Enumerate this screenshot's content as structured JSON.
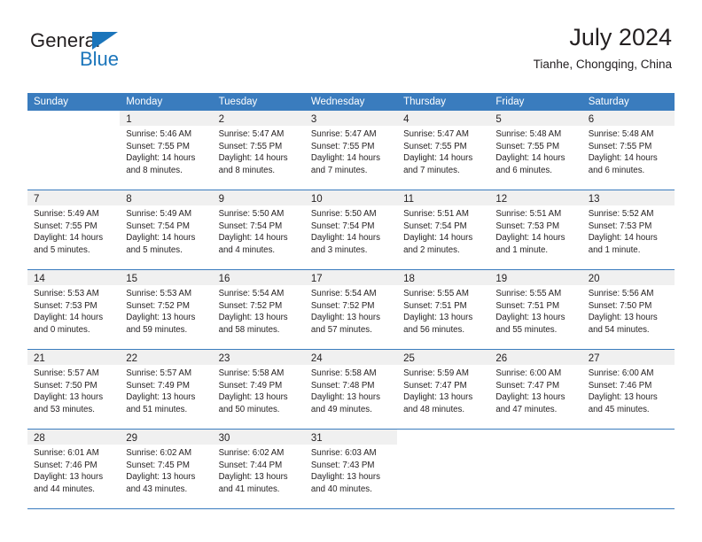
{
  "brand": {
    "name_dark": "General",
    "name_blue": "Blue",
    "flag_icon": "triangle-flag-icon",
    "accent_color": "#1b75bb"
  },
  "header": {
    "title": "July 2024",
    "subtitle": "Tianhe, Chongqing, China"
  },
  "calendar": {
    "header_color": "#3a7cbe",
    "weekdays": [
      "Sunday",
      "Monday",
      "Tuesday",
      "Wednesday",
      "Thursday",
      "Friday",
      "Saturday"
    ],
    "weeks": [
      [
        {
          "day": "",
          "lines": []
        },
        {
          "day": "1",
          "lines": [
            "Sunrise: 5:46 AM",
            "Sunset: 7:55 PM",
            "Daylight: 14 hours",
            "and 8 minutes."
          ]
        },
        {
          "day": "2",
          "lines": [
            "Sunrise: 5:47 AM",
            "Sunset: 7:55 PM",
            "Daylight: 14 hours",
            "and 8 minutes."
          ]
        },
        {
          "day": "3",
          "lines": [
            "Sunrise: 5:47 AM",
            "Sunset: 7:55 PM",
            "Daylight: 14 hours",
            "and 7 minutes."
          ]
        },
        {
          "day": "4",
          "lines": [
            "Sunrise: 5:47 AM",
            "Sunset: 7:55 PM",
            "Daylight: 14 hours",
            "and 7 minutes."
          ]
        },
        {
          "day": "5",
          "lines": [
            "Sunrise: 5:48 AM",
            "Sunset: 7:55 PM",
            "Daylight: 14 hours",
            "and 6 minutes."
          ]
        },
        {
          "day": "6",
          "lines": [
            "Sunrise: 5:48 AM",
            "Sunset: 7:55 PM",
            "Daylight: 14 hours",
            "and 6 minutes."
          ]
        }
      ],
      [
        {
          "day": "7",
          "lines": [
            "Sunrise: 5:49 AM",
            "Sunset: 7:55 PM",
            "Daylight: 14 hours",
            "and 5 minutes."
          ]
        },
        {
          "day": "8",
          "lines": [
            "Sunrise: 5:49 AM",
            "Sunset: 7:54 PM",
            "Daylight: 14 hours",
            "and 5 minutes."
          ]
        },
        {
          "day": "9",
          "lines": [
            "Sunrise: 5:50 AM",
            "Sunset: 7:54 PM",
            "Daylight: 14 hours",
            "and 4 minutes."
          ]
        },
        {
          "day": "10",
          "lines": [
            "Sunrise: 5:50 AM",
            "Sunset: 7:54 PM",
            "Daylight: 14 hours",
            "and 3 minutes."
          ]
        },
        {
          "day": "11",
          "lines": [
            "Sunrise: 5:51 AM",
            "Sunset: 7:54 PM",
            "Daylight: 14 hours",
            "and 2 minutes."
          ]
        },
        {
          "day": "12",
          "lines": [
            "Sunrise: 5:51 AM",
            "Sunset: 7:53 PM",
            "Daylight: 14 hours",
            "and 1 minute."
          ]
        },
        {
          "day": "13",
          "lines": [
            "Sunrise: 5:52 AM",
            "Sunset: 7:53 PM",
            "Daylight: 14 hours",
            "and 1 minute."
          ]
        }
      ],
      [
        {
          "day": "14",
          "lines": [
            "Sunrise: 5:53 AM",
            "Sunset: 7:53 PM",
            "Daylight: 14 hours",
            "and 0 minutes."
          ]
        },
        {
          "day": "15",
          "lines": [
            "Sunrise: 5:53 AM",
            "Sunset: 7:52 PM",
            "Daylight: 13 hours",
            "and 59 minutes."
          ]
        },
        {
          "day": "16",
          "lines": [
            "Sunrise: 5:54 AM",
            "Sunset: 7:52 PM",
            "Daylight: 13 hours",
            "and 58 minutes."
          ]
        },
        {
          "day": "17",
          "lines": [
            "Sunrise: 5:54 AM",
            "Sunset: 7:52 PM",
            "Daylight: 13 hours",
            "and 57 minutes."
          ]
        },
        {
          "day": "18",
          "lines": [
            "Sunrise: 5:55 AM",
            "Sunset: 7:51 PM",
            "Daylight: 13 hours",
            "and 56 minutes."
          ]
        },
        {
          "day": "19",
          "lines": [
            "Sunrise: 5:55 AM",
            "Sunset: 7:51 PM",
            "Daylight: 13 hours",
            "and 55 minutes."
          ]
        },
        {
          "day": "20",
          "lines": [
            "Sunrise: 5:56 AM",
            "Sunset: 7:50 PM",
            "Daylight: 13 hours",
            "and 54 minutes."
          ]
        }
      ],
      [
        {
          "day": "21",
          "lines": [
            "Sunrise: 5:57 AM",
            "Sunset: 7:50 PM",
            "Daylight: 13 hours",
            "and 53 minutes."
          ]
        },
        {
          "day": "22",
          "lines": [
            "Sunrise: 5:57 AM",
            "Sunset: 7:49 PM",
            "Daylight: 13 hours",
            "and 51 minutes."
          ]
        },
        {
          "day": "23",
          "lines": [
            "Sunrise: 5:58 AM",
            "Sunset: 7:49 PM",
            "Daylight: 13 hours",
            "and 50 minutes."
          ]
        },
        {
          "day": "24",
          "lines": [
            "Sunrise: 5:58 AM",
            "Sunset: 7:48 PM",
            "Daylight: 13 hours",
            "and 49 minutes."
          ]
        },
        {
          "day": "25",
          "lines": [
            "Sunrise: 5:59 AM",
            "Sunset: 7:47 PM",
            "Daylight: 13 hours",
            "and 48 minutes."
          ]
        },
        {
          "day": "26",
          "lines": [
            "Sunrise: 6:00 AM",
            "Sunset: 7:47 PM",
            "Daylight: 13 hours",
            "and 47 minutes."
          ]
        },
        {
          "day": "27",
          "lines": [
            "Sunrise: 6:00 AM",
            "Sunset: 7:46 PM",
            "Daylight: 13 hours",
            "and 45 minutes."
          ]
        }
      ],
      [
        {
          "day": "28",
          "lines": [
            "Sunrise: 6:01 AM",
            "Sunset: 7:46 PM",
            "Daylight: 13 hours",
            "and 44 minutes."
          ]
        },
        {
          "day": "29",
          "lines": [
            "Sunrise: 6:02 AM",
            "Sunset: 7:45 PM",
            "Daylight: 13 hours",
            "and 43 minutes."
          ]
        },
        {
          "day": "30",
          "lines": [
            "Sunrise: 6:02 AM",
            "Sunset: 7:44 PM",
            "Daylight: 13 hours",
            "and 41 minutes."
          ]
        },
        {
          "day": "31",
          "lines": [
            "Sunrise: 6:03 AM",
            "Sunset: 7:43 PM",
            "Daylight: 13 hours",
            "and 40 minutes."
          ]
        },
        {
          "day": "",
          "lines": []
        },
        {
          "day": "",
          "lines": []
        },
        {
          "day": "",
          "lines": []
        }
      ]
    ]
  }
}
